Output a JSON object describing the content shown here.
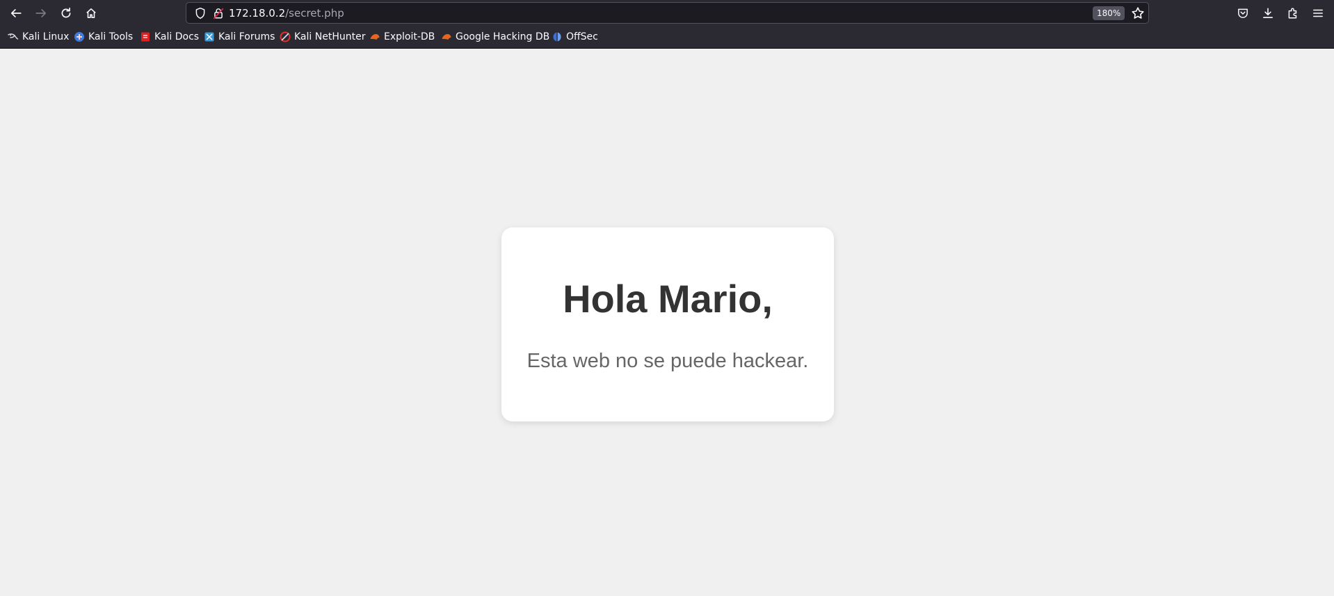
{
  "browser": {
    "url_host": "172.18.0.2",
    "url_path": "/secret.php",
    "zoom": "180%",
    "nav_icons": [
      "back-icon",
      "forward-icon",
      "reload-icon",
      "home-icon"
    ],
    "right_icons": [
      "pocket-icon",
      "download-icon",
      "extensions-icon",
      "menu-icon"
    ]
  },
  "bookmarks": [
    {
      "label": "Kali Linux",
      "icon": "kali-dragon-icon",
      "color": "#e0e0e0"
    },
    {
      "label": "Kali Tools",
      "icon": "kali-tools-icon",
      "color": "#3d7be0"
    },
    {
      "label": "Kali Docs",
      "icon": "kali-docs-icon",
      "color": "#e02020"
    },
    {
      "label": "Kali Forums",
      "icon": "kali-forums-icon",
      "color": "#3a9ad9"
    },
    {
      "label": "Kali NetHunter",
      "icon": "nethunter-icon",
      "color": "#e03030"
    },
    {
      "label": "Exploit-DB",
      "icon": "exploit-db-icon",
      "color": "#e8651e"
    },
    {
      "label": "Google Hacking DB",
      "icon": "ghdb-icon",
      "color": "#e8651e"
    },
    {
      "label": "OffSec",
      "icon": "offsec-icon",
      "color": "#3b6fd6"
    }
  ],
  "page": {
    "heading": "Hola Mario,",
    "message": "Esta web no se puede hackear."
  }
}
